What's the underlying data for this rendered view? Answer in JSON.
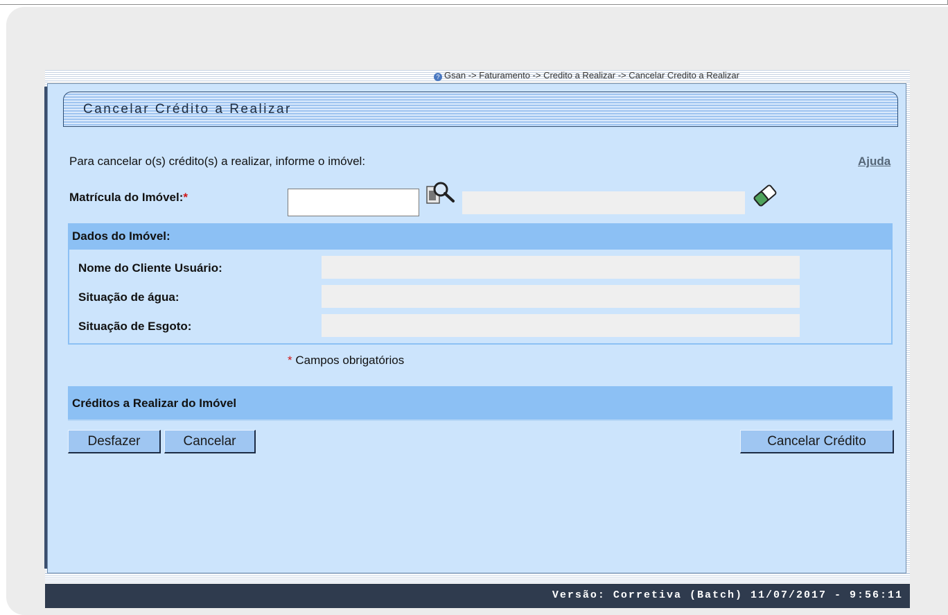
{
  "breadcrumb": "Gsan -> Faturamento -> Credito a Realizar -> Cancelar Credito a Realizar",
  "page_title": "Cancelar Crédito a Realizar",
  "intro_text": "Para cancelar o(s) crédito(s) a realizar, informe o imóvel:",
  "help_link": "Ajuda",
  "matricula": {
    "label": "Matrícula do Imóvel:",
    "required_mark": "*",
    "value": "",
    "description": ""
  },
  "dados_imovel": {
    "header": "Dados do Imóvel:",
    "fields": [
      {
        "label": "Nome do Cliente Usuário:",
        "value": ""
      },
      {
        "label": "Situação de água:",
        "value": ""
      },
      {
        "label": "Situação de Esgoto:",
        "value": ""
      }
    ]
  },
  "required_note": {
    "mark": "*",
    "text": " Campos obrigatórios"
  },
  "creditos_header": "Créditos a Realizar do Imóvel",
  "buttons": {
    "undo": "Desfazer",
    "cancel": "Cancelar",
    "cancel_credit": "Cancelar Crédito"
  },
  "footer": "Versão: Corretiva (Batch) 11/07/2017 - 9:56:11",
  "icons": {
    "help": "help-icon",
    "search": "search-icon",
    "clear": "eraser-icon"
  }
}
